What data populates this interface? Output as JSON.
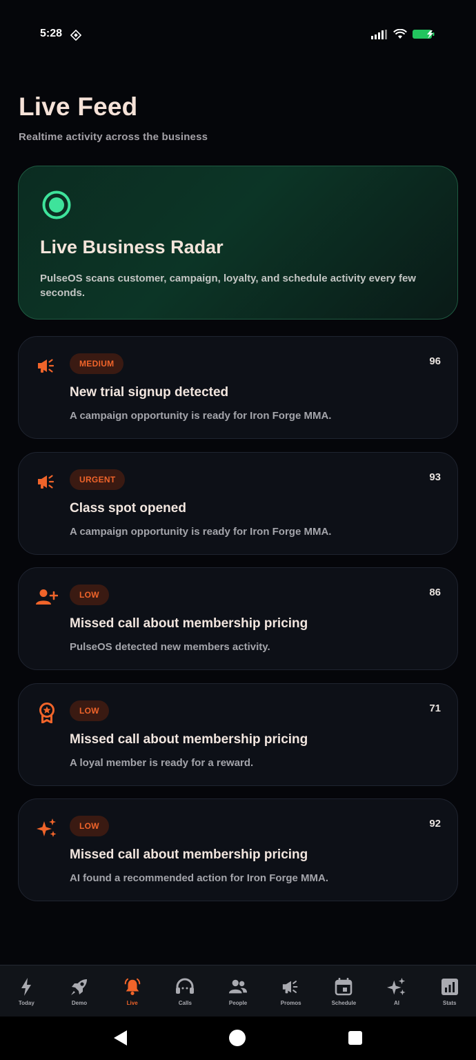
{
  "status_bar": {
    "time": "5:28"
  },
  "header": {
    "title": "Live Feed",
    "subtitle": "Realtime activity across the business"
  },
  "radar": {
    "title": "Live Business Radar",
    "description": "PulseOS scans customer, campaign, loyalty, and schedule activity every few seconds.",
    "icon": "radio-button-icon",
    "accent_color": "#3ee39b"
  },
  "feed": [
    {
      "icon": "megaphone-icon",
      "priority": "MEDIUM",
      "score": "96",
      "title": "New trial signup detected",
      "description": "A campaign opportunity is ready for Iron Forge MMA."
    },
    {
      "icon": "megaphone-icon",
      "priority": "URGENT",
      "score": "93",
      "title": "Class spot opened",
      "description": "A campaign opportunity is ready for Iron Forge MMA."
    },
    {
      "icon": "person-add-icon",
      "priority": "LOW",
      "score": "86",
      "title": "Missed call about membership pricing",
      "description": "PulseOS detected new members activity."
    },
    {
      "icon": "award-badge-icon",
      "priority": "LOW",
      "score": "71",
      "title": "Missed call about membership pricing",
      "description": "A loyal member is ready for a reward."
    },
    {
      "icon": "sparkles-icon",
      "priority": "LOW",
      "score": "92",
      "title": "Missed call about membership pricing",
      "description": "AI found a recommended action for Iron Forge MMA."
    }
  ],
  "bottom_nav": [
    {
      "label": "Today",
      "icon": "bolt-icon",
      "active": false
    },
    {
      "label": "Demo",
      "icon": "rocket-icon",
      "active": false
    },
    {
      "label": "Live",
      "icon": "bell-icon",
      "active": true
    },
    {
      "label": "Calls",
      "icon": "headset-icon",
      "active": false
    },
    {
      "label": "People",
      "icon": "people-icon",
      "active": false
    },
    {
      "label": "Promos",
      "icon": "megaphone-icon",
      "active": false
    },
    {
      "label": "Schedule",
      "icon": "calendar-icon",
      "active": false
    },
    {
      "label": "AI",
      "icon": "sparkles-icon",
      "active": false
    },
    {
      "label": "Stats",
      "icon": "bar-chart-icon",
      "active": false
    }
  ],
  "colors": {
    "background": "#05060a",
    "card": "#0d1017",
    "accent": "#f0642a",
    "radar_green": "#3ee39b"
  }
}
